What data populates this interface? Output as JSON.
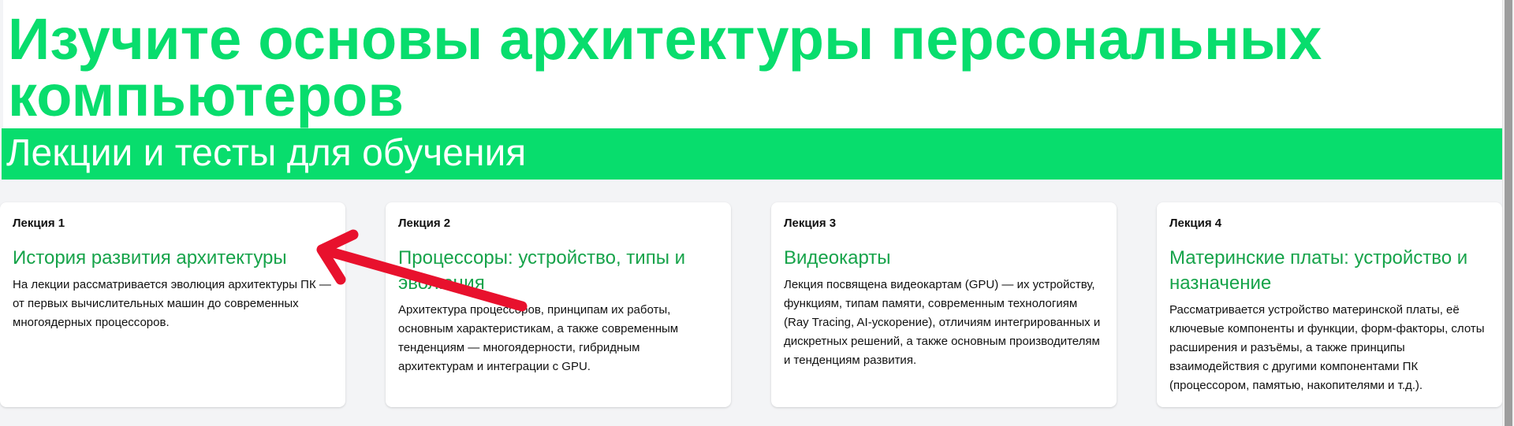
{
  "hero": {
    "title": "Изучите основы архитектуры персональных компьютеров"
  },
  "banner": {
    "subtitle": "Лекции и тесты для обучения"
  },
  "cards": [
    {
      "number": "Лекция 1",
      "title": "История развития архитектуры",
      "description": "На лекции рассматривается эволюция архитектуры ПК — от первых вычислительных машин до современных многоядерных процессоров."
    },
    {
      "number": "Лекция 2",
      "title": "Процессоры: устройство, типы и эволюция",
      "description": "Архитектура процессоров, принципам их работы, основным характеристикам, а также современным тенденциям — многоядерности, гибридным архитектурам и интеграции с GPU."
    },
    {
      "number": "Лекция 3",
      "title": "Видеокарты",
      "description": "Лекция посвящена видеокартам (GPU) — их устройству, функциям, типам памяти, современным технологиям (Ray Tracing, AI-ускорение), отличиям интегрированных и дискретных решений, а также основным производителям и тенденциям развития."
    },
    {
      "number": "Лекция 4",
      "title": "Материнские платы: устройство и назначение",
      "description": "Рассматривается устройство материнской платы, её ключевые компоненты и функции, форм-факторы, слоты расширения и разъёмы, а также принципы взаимодействия с другими компонентами ПК (процессором, памятью, накопителями и т.д.)."
    }
  ],
  "colors": {
    "accent": "#08dd6d",
    "card_title": "#16a34a",
    "annotation_arrow": "#e8112d"
  }
}
